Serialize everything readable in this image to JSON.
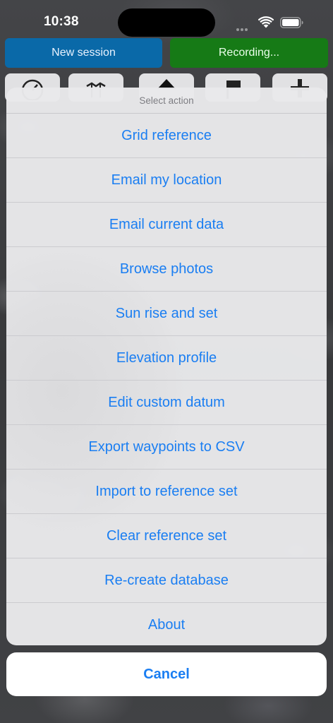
{
  "status_bar": {
    "time": "10:38",
    "icons": [
      "wifi-icon",
      "battery-icon"
    ]
  },
  "header": {
    "new_session_label": "New session",
    "recording_label": "Recording..."
  },
  "toolbar": {
    "icons": [
      "compass-icon",
      "map-icon",
      "waypoint-icon",
      "flag-icon",
      "plus-icon"
    ]
  },
  "action_sheet": {
    "title": "Select action",
    "items": [
      "Grid reference",
      "Email my location",
      "Email current data",
      "Browse photos",
      "Sun rise and set",
      "Elevation profile",
      "Edit custom datum",
      "Export waypoints to CSV",
      "Import to reference set",
      "Clear reference set",
      "Re-create database",
      "About"
    ],
    "cancel_label": "Cancel"
  },
  "colors": {
    "accent_blue": "#1a7ef2",
    "new_session_bg": "#0a69a8",
    "recording_bg": "#167a16"
  }
}
